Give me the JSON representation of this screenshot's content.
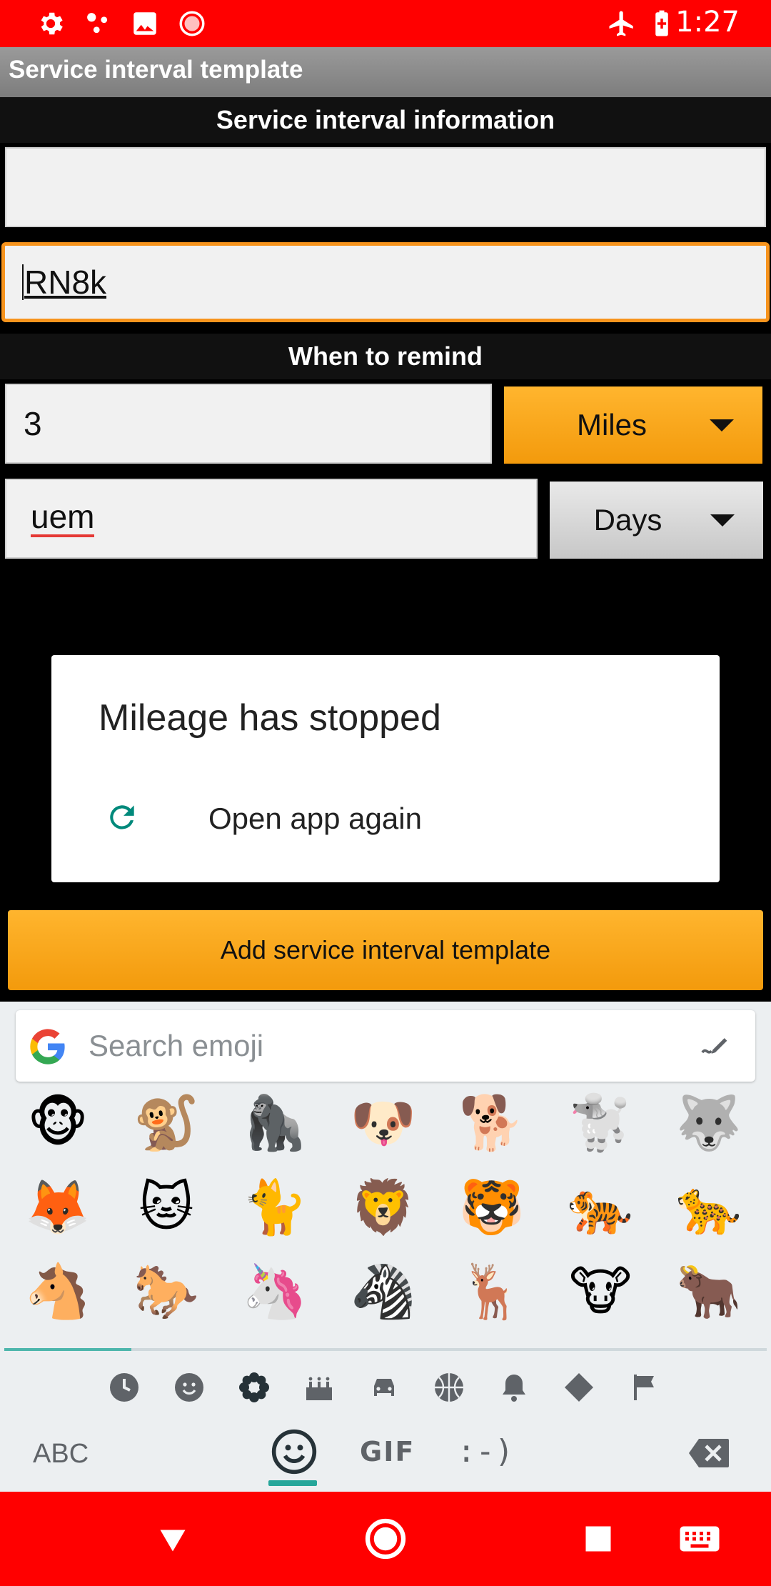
{
  "status_bar": {
    "time": "1:27",
    "left_icons": [
      "gear-icon",
      "dots-icon",
      "image-icon",
      "record-icon"
    ],
    "right_icons": [
      "airplane-icon",
      "battery-icon"
    ]
  },
  "app_bar": {
    "title": "Service interval template"
  },
  "section_info": {
    "label": "Service interval information"
  },
  "name_field": {
    "value": ""
  },
  "code_field": {
    "value": "RN8k"
  },
  "section_remind": {
    "label": "When to remind"
  },
  "miles_field": {
    "value": "3"
  },
  "miles_spinner": {
    "selected": "Miles"
  },
  "days_field": {
    "value": "uem"
  },
  "days_spinner": {
    "selected": "Days"
  },
  "dialog": {
    "title": "Mileage has stopped",
    "action": "Open app again"
  },
  "add_button": {
    "label": "Add service interval template"
  },
  "keyboard": {
    "search_placeholder": "Search emoji",
    "emojis": [
      "🐵",
      "🐒",
      "🦍",
      "🐶",
      "🐕",
      "🐩",
      "🐺",
      "🦊",
      "🐱",
      "🐈",
      "🦁",
      "🐯",
      "🐅",
      "🐆",
      "🐴",
      "🐎",
      "🦄",
      "🦓",
      "🦌",
      "🐮",
      "🐂"
    ],
    "categories": [
      "clock-icon",
      "smiley-icon",
      "flower-icon",
      "cake-icon",
      "car-icon",
      "ball-icon",
      "bell-icon",
      "diamond-icon",
      "flag-icon"
    ],
    "abc_label": "ABC",
    "gif_label": "GIF",
    "emoticon_label": ":-)"
  },
  "colors": {
    "status_bar": "#ff0000",
    "accent_orange": "#f7a21a",
    "teal": "#26a69a"
  }
}
